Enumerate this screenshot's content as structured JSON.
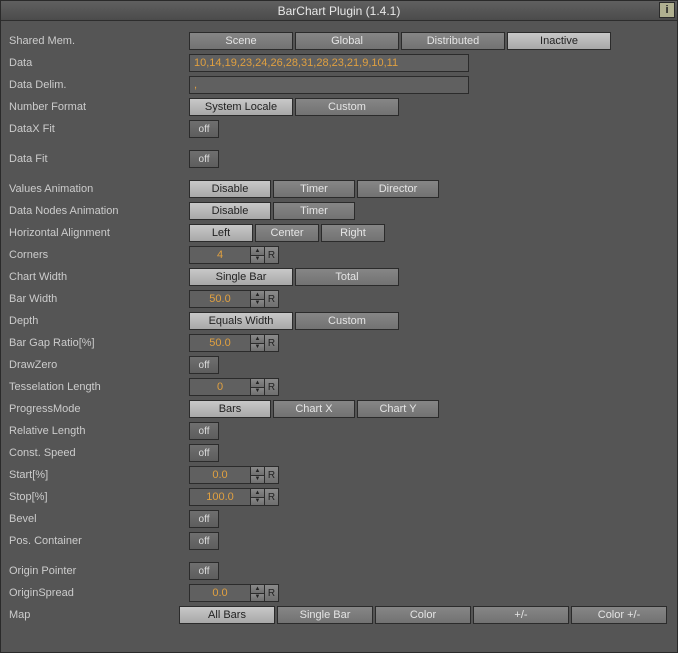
{
  "title": "BarChart Plugin (1.4.1)",
  "info_icon": "i",
  "labels": {
    "shared_mem": "Shared Mem.",
    "data": "Data",
    "data_delim": "Data Delim.",
    "number_format": "Number Format",
    "datax_fit": "DataX Fit",
    "data_fit": "Data Fit",
    "values_anim": "Values Animation",
    "nodes_anim": "Data Nodes Animation",
    "halign": "Horizontal Alignment",
    "corners": "Corners",
    "chart_width": "Chart Width",
    "bar_width": "Bar Width",
    "depth": "Depth",
    "gap_ratio": "Bar Gap Ratio[%]",
    "draw_zero": "DrawZero",
    "tess_len": "Tesselation Length",
    "progress_mode": "ProgressMode",
    "rel_len": "Relative Length",
    "const_speed": "Const. Speed",
    "start": "Start[%]",
    "stop": "Stop[%]",
    "bevel": "Bevel",
    "pos_container": "Pos. Container",
    "origin_pointer": "Origin Pointer",
    "origin_spread": "OriginSpread",
    "map": "Map"
  },
  "shared_mem": {
    "scene": "Scene",
    "global": "Global",
    "distributed": "Distributed",
    "inactive": "Inactive"
  },
  "data_value": "10,14,19,23,24,26,28,31,28,23,21,9,10,11",
  "delim_value": ",",
  "number_format": {
    "system": "System Locale",
    "custom": "Custom"
  },
  "off": "off",
  "values_anim": {
    "disable": "Disable",
    "timer": "Timer",
    "director": "Director"
  },
  "nodes_anim": {
    "disable": "Disable",
    "timer": "Timer"
  },
  "halign": {
    "left": "Left",
    "center": "Center",
    "right": "Right"
  },
  "corners": "4",
  "chart_width": {
    "single": "Single Bar",
    "total": "Total"
  },
  "bar_width": "50.0",
  "depth": {
    "eq": "Equals Width",
    "custom": "Custom"
  },
  "gap_ratio": "50.0",
  "tess_len": "0",
  "progress_mode": {
    "bars": "Bars",
    "chartx": "Chart X",
    "charty": "Chart Y"
  },
  "start": "0.0",
  "stop": "100.0",
  "origin_spread": "0.0",
  "map": {
    "all": "All Bars",
    "single": "Single Bar",
    "color": "Color",
    "pm": "+/-",
    "colorpm": "Color +/-"
  },
  "reset": "R"
}
